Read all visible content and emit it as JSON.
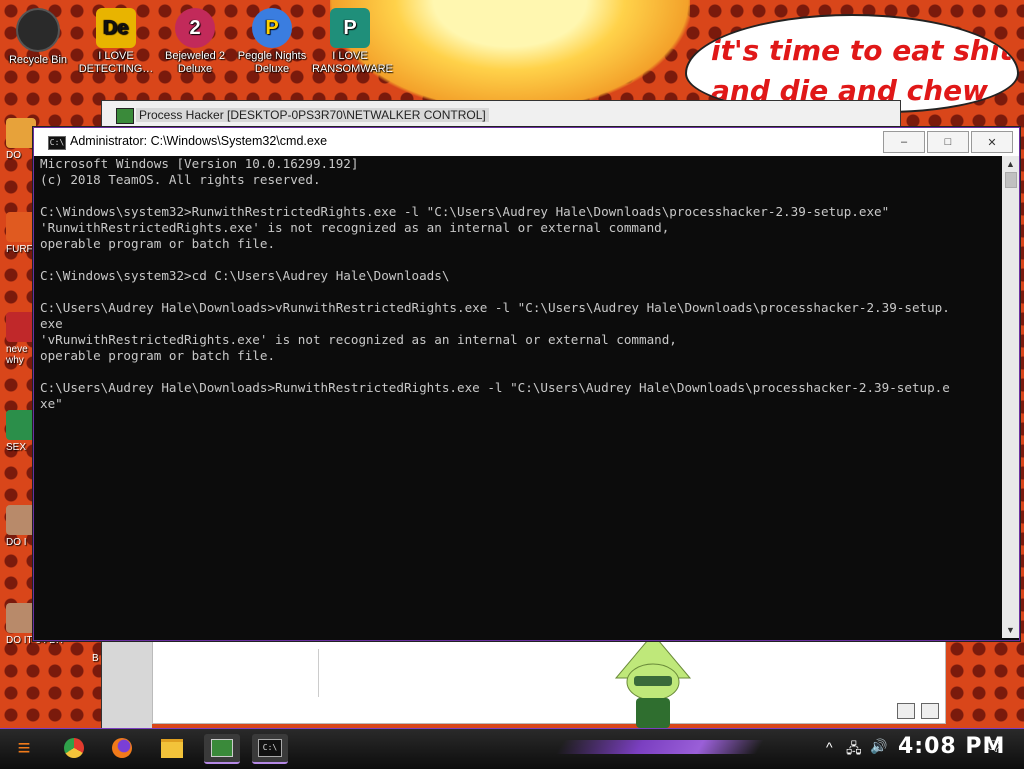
{
  "desktop": {
    "icons": [
      {
        "label": "Recycle Bin",
        "glyph": "",
        "color": "#2a2a2a"
      },
      {
        "label": "I LOVE DETECTING…",
        "glyph": "De",
        "color": "#e8b400"
      },
      {
        "label": "Bejeweled 2 Deluxe",
        "glyph": "2",
        "color": "#c22a5a"
      },
      {
        "label": "Peggle Nights Deluxe",
        "glyph": "P",
        "color": "#3a7de0"
      },
      {
        "label": "I LOVE RANSOMWARE",
        "glyph": "P",
        "color": "#1f8f7a"
      }
    ],
    "left_icons": [
      {
        "label": "DO",
        "color": "#e7a23a"
      },
      {
        "label": "FURF",
        "color": "#e05a20"
      },
      {
        "label": "neve why",
        "color": "#c0282a"
      },
      {
        "label": "SEX",
        "color": "#2b8f4a"
      },
      {
        "label": "DO I",
        "color": "#b88a6a"
      },
      {
        "label": "DO IT 64 BIT",
        "color": "#b88a6a"
      }
    ],
    "stray_label": "B",
    "speech_bubble": [
      "it's time to eat shit",
      "and die and chew"
    ]
  },
  "process_hacker": {
    "title": "Process Hacker [DESKTOP-0PS3R70\\NETWALKER CONTROL]"
  },
  "cmd": {
    "title": "Administrator: C:\\Windows\\System32\\cmd.exe",
    "icon_text": "C:\\",
    "buttons": {
      "minimize": "–",
      "maximize": "□",
      "close": "✕"
    },
    "console_lines": [
      "Microsoft Windows [Version 10.0.16299.192]",
      "(c) 2018 TeamOS. All rights reserved.",
      "",
      "C:\\Windows\\system32>RunwithRestrictedRights.exe -l \"C:\\Users\\Audrey Hale\\Downloads\\processhacker-2.39-setup.exe\"",
      "'RunwithRestrictedRights.exe' is not recognized as an internal or external command,",
      "operable program or batch file.",
      "",
      "C:\\Windows\\system32>cd C:\\Users\\Audrey Hale\\Downloads\\",
      "",
      "C:\\Users\\Audrey Hale\\Downloads>vRunwithRestrictedRights.exe -l \"C:\\Users\\Audrey Hale\\Downloads\\processhacker-2.39-setup.",
      "exe",
      "'vRunwithRestrictedRights.exe' is not recognized as an internal or external command,",
      "operable program or batch file.",
      "",
      "C:\\Users\\Audrey Hale\\Downloads>RunwithRestrictedRights.exe -l \"C:\\Users\\Audrey Hale\\Downloads\\processhacker-2.39-setup.e",
      "xe\""
    ],
    "scroll_up": "▲",
    "scroll_down": "▼"
  },
  "taskbar": {
    "start_glyph": "≡",
    "pinned": [
      {
        "name": "chrome",
        "color": "#e23b2e"
      },
      {
        "name": "firefox",
        "color": "#f17a1a"
      },
      {
        "name": "file-explorer",
        "color": "#f3c33a"
      },
      {
        "name": "process-hacker",
        "color": "#3a8a3a"
      },
      {
        "name": "cmd",
        "color": "#111111"
      }
    ],
    "cmd_icon_text": "C:\\",
    "tray": {
      "chevron": "^",
      "network": "🖧",
      "volume": "🔊",
      "notification": "🗨"
    },
    "clock": "4:08 PM"
  },
  "colors": {
    "console_text": "#c8c8c8",
    "console_bg": "#0c0c0c",
    "accent_purple": "#7b3fc1",
    "bubble_text": "#e01818"
  }
}
